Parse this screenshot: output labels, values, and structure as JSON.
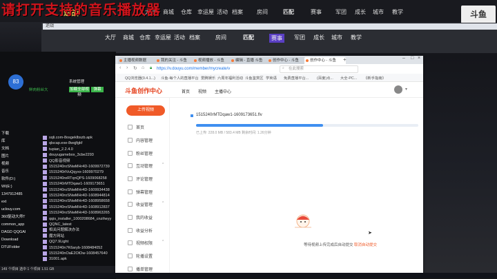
{
  "overlay_title": "请打开支持的音乐播放器",
  "game": {
    "logo_text": "逆战",
    "nav": [
      "大厅",
      "商城",
      "仓库",
      "幸运屋",
      "活动",
      "档案"
    ],
    "mid_tabs": [
      "房间",
      "匹配",
      "赛事"
    ],
    "right_nav": [
      "军团",
      "成长",
      "城市",
      "教学"
    ],
    "corner_logo": "斗鱼",
    "window2_title": "逆战"
  },
  "left_panel": {
    "counter": "83",
    "chat_label": "鲜肉粉丝大",
    "quick_items": [
      "加载全部视频",
      "弹幕",
      "系统管理"
    ],
    "tree": [
      "下载",
      "库",
      "文档",
      "图片",
      "视频",
      "音乐",
      "软件(D:)",
      "WI(E:)",
      "1347912485",
      "ext",
      "uclouy.com",
      "360驱动大师T",
      "common_app",
      "DAGD QQGAI",
      "Download",
      "DTUFolder"
    ],
    "files": [
      "sqli.com-8osgeklbszb.apk",
      "qlscap.exe-8wqjfgkf",
      "tupian_2.2.4.0",
      "douyugamebox_3cbe2293",
      "QQ影音视频",
      "1515240roSNwMHr4D-1609972739",
      "1515240rlVuQqyxx-1609970279",
      "1515240reRTqnQPS-1609068258",
      "1515240rMTDqaw1-1609173651",
      "1515240roSNwMHr4D-1609934438",
      "1515240roSNwMHr4D-1608944814",
      "1515240roSNwMHr4D-1608958658",
      "1515240roSNwMHr4D-1608912837",
      "1515240roSNwMHr4D-1608963265",
      "qqis_installer_1000208684_cnziheyy",
      "QQNC_latest",
      "相关问题解决办法",
      "魔方网站",
      "QQ7.9Light",
      "1515240n7K6aryb-1608484052",
      "1515240nOaE2OlOw-1608457640",
      "31001.apk"
    ],
    "status_bar": "149 个项目    选中 1 个项目   1.51 GB"
  },
  "browser": {
    "tabs": [
      "主播视频数据",
      "我的关注 - 斗鱼",
      "视频播放 - 斗鱼",
      "编辑 - 直播 斗鱼",
      "创作中心 - 斗鱼",
      "创作中心 - 斗鱼"
    ],
    "url": "https://v.douyu.com/member/mycreate/v",
    "search_placeholder": "在此搜索",
    "bookmarks": [
      "QQ浏览器(9.4.1...)",
      "斗鱼-每个人的直播平台",
      "爱腾娱乐",
      "六周年福利活动",
      "斗鱼鉴赏区",
      "学英语",
      "免费直播平台...",
      "(百度)点...",
      "大全-PC...",
      "《新手指南》"
    ],
    "site": {
      "logo": "斗鱼创作中心",
      "nav": [
        "首页",
        "视频",
        "主播中心"
      ],
      "upload_button": "上传视频",
      "menu": [
        {
          "label": "首页",
          "group": false
        },
        {
          "label": "内容管理",
          "group": false
        },
        {
          "label": "粉丝管理",
          "group": false
        },
        {
          "label": "互动管理",
          "group": true
        },
        {
          "label": "评论管理",
          "group": false
        },
        {
          "label": "弹幕管理",
          "group": false
        },
        {
          "label": "收益管理",
          "group": true
        },
        {
          "label": "我的收益",
          "group": false
        },
        {
          "label": "收益分析",
          "group": false
        },
        {
          "label": "视频权限",
          "group": true
        },
        {
          "label": "轮播设置",
          "group": false
        },
        {
          "label": "播单管理",
          "group": false
        }
      ],
      "upload": {
        "filename": "1515240rMTDqaw1-1609173651.flv",
        "stats": "已上传: 228.0 MB / 583.4 MB    剩余时间: 1.26分钟",
        "progress": 0.57
      },
      "hint": "等待视频上传完成后自动提交",
      "hint_link": "取消自动提交"
    }
  },
  "colors": {
    "accent": "#f05a28",
    "progress": "#3f8ff0",
    "overlay_red": "#d0141c"
  }
}
